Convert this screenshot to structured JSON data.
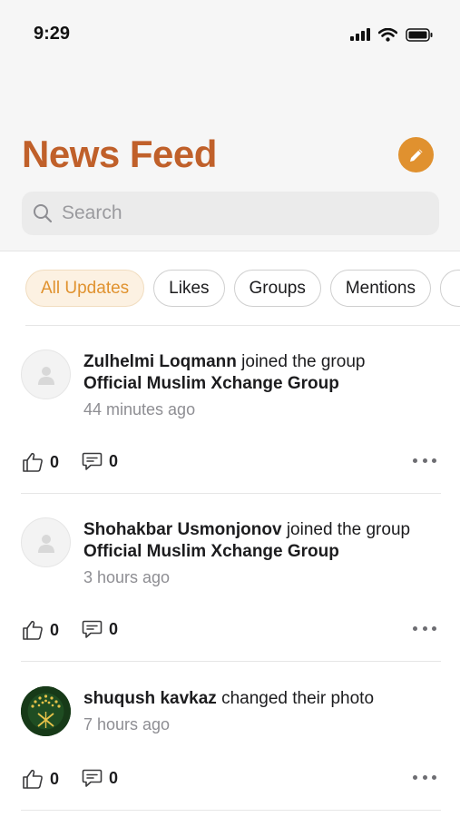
{
  "status_bar": {
    "time": "9:29"
  },
  "header": {
    "title": "News Feed"
  },
  "search": {
    "placeholder": "Search",
    "value": ""
  },
  "filters": [
    {
      "label": "All Updates",
      "active": true
    },
    {
      "label": "Likes",
      "active": false
    },
    {
      "label": "Groups",
      "active": false
    },
    {
      "label": "Mentions",
      "active": false
    }
  ],
  "feed": [
    {
      "user": "Zulhelmi Loqmann",
      "action": "joined the group",
      "target": "Official Muslim Xchange Group",
      "time": "44 minutes ago",
      "likes": "0",
      "comments": "0",
      "avatar": "placeholder"
    },
    {
      "user": "Shohakbar Usmonjonov",
      "action": "joined the group",
      "target": "Official Muslim Xchange Group",
      "time": "3 hours ago",
      "likes": "0",
      "comments": "0",
      "avatar": "placeholder"
    },
    {
      "user": "shuqush kavkaz",
      "action": "changed their photo",
      "target": "",
      "time": "7 hours ago",
      "likes": "0",
      "comments": "0",
      "avatar": "photo"
    }
  ],
  "colors": {
    "accent": "#e0912f",
    "title": "#c0602a",
    "muted": "#8e8e93"
  },
  "icons": [
    "signal-icon",
    "wifi-icon",
    "battery-icon",
    "pencil-icon",
    "search-icon",
    "thumbs-up-icon",
    "comment-icon",
    "more-icon",
    "user-placeholder-icon"
  ]
}
